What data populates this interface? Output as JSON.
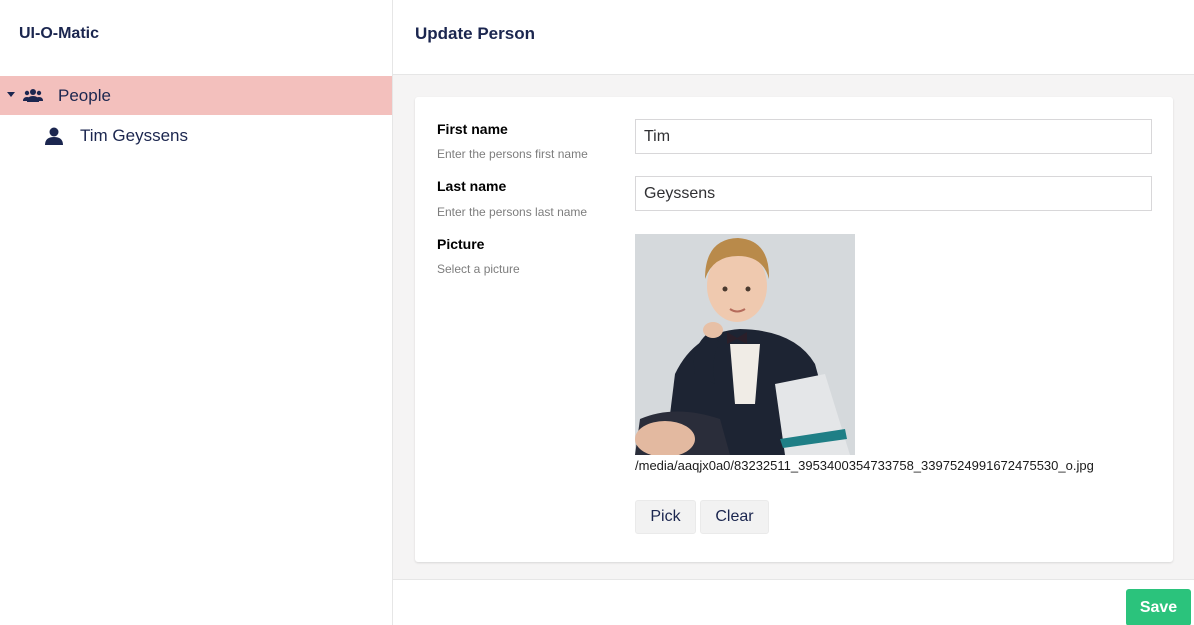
{
  "app": {
    "title": "UI-O-Matic"
  },
  "sidebar": {
    "root": {
      "label": "People",
      "icon": "people-icon",
      "expanded": true
    },
    "items": [
      {
        "label": "Tim Geyssens",
        "icon": "person-icon"
      }
    ]
  },
  "header": {
    "title": "Update Person"
  },
  "form": {
    "first_name": {
      "label": "First name",
      "description": "Enter the persons first name",
      "value": "Tim"
    },
    "last_name": {
      "label": "Last name",
      "description": "Enter the persons last name",
      "value": "Geyssens"
    },
    "picture": {
      "label": "Picture",
      "description": "Select a picture",
      "path": "/media/aaqjx0a0/83232511_3953400354733758_3397524991672475530_o.jpg",
      "pick_label": "Pick",
      "clear_label": "Clear"
    }
  },
  "footer": {
    "save_label": "Save"
  },
  "colors": {
    "accent": "#f3c0bd",
    "text": "#1b264f",
    "save": "#2bc37c"
  }
}
